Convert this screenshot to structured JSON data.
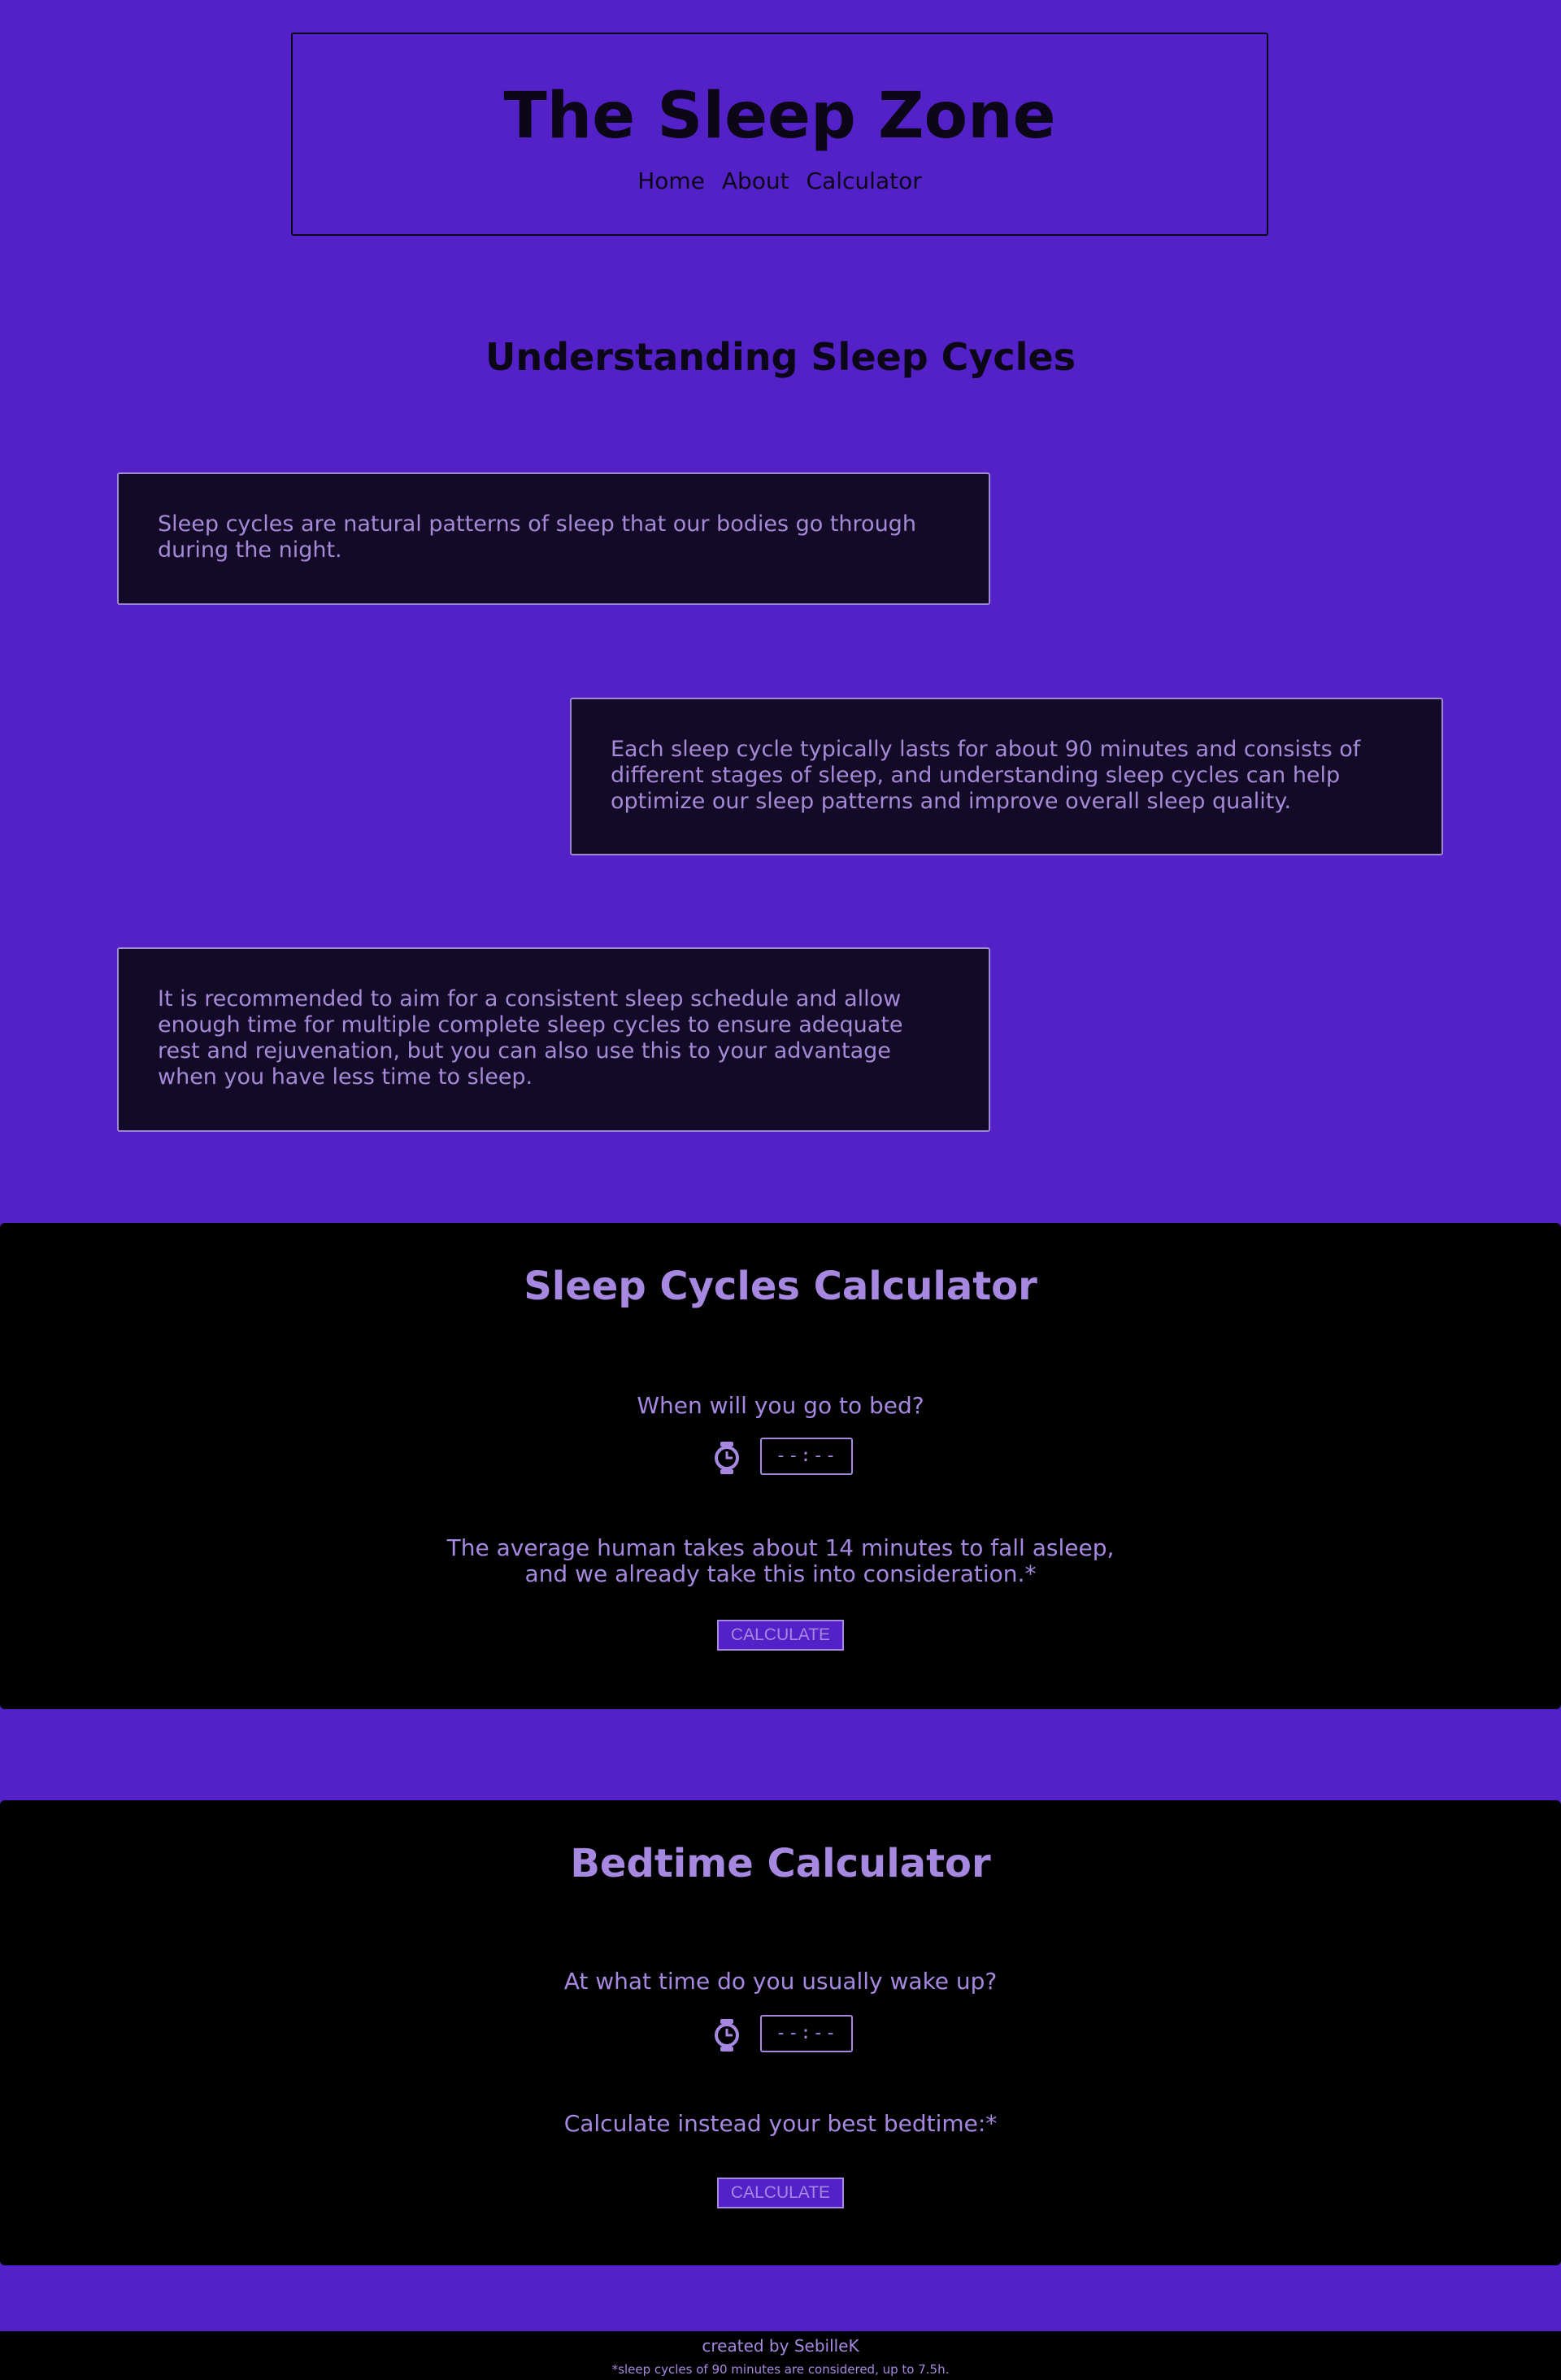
{
  "header": {
    "title": "The Sleep Zone",
    "nav": [
      "Home",
      "About",
      "Calculator"
    ]
  },
  "intro": {
    "heading": "Understanding Sleep Cycles",
    "paragraphs": [
      "Sleep cycles are natural patterns of sleep that our bodies go through during the night.",
      "Each sleep cycle typically lasts for about 90 minutes and consists of different stages of sleep, and understanding sleep cycles can help optimize our sleep patterns and improve overall sleep quality.",
      "It is recommended to aim for a consistent sleep schedule and allow enough time for multiple complete sleep cycles to ensure adequate rest and rejuvenation, but you can also use this to your advantage when you have less time to sleep."
    ]
  },
  "sleep_calc": {
    "title": "Sleep Cycles Calculator",
    "question": "When will you go to bed?",
    "time_value": "--:--",
    "note_line1": "The average human takes about 14 minutes to fall asleep,",
    "note_line2": "and we already take this into consideration.*",
    "button": "CALCULATE"
  },
  "bedtime_calc": {
    "title": "Bedtime Calculator",
    "question": "At what time do you usually wake up?",
    "time_value": "--:--",
    "note": "Calculate instead your best bedtime:*",
    "button": "CALCULATE"
  },
  "footer": {
    "credit": "created by SebilleK",
    "note": "*sleep cycles of 90 minutes are considered, up to 7.5h."
  },
  "colors": {
    "background": "#5321c7",
    "dark": "#0c0716",
    "box": "#120a26",
    "accent_text": "#a688e0"
  },
  "icons": [
    "watch-icon"
  ]
}
